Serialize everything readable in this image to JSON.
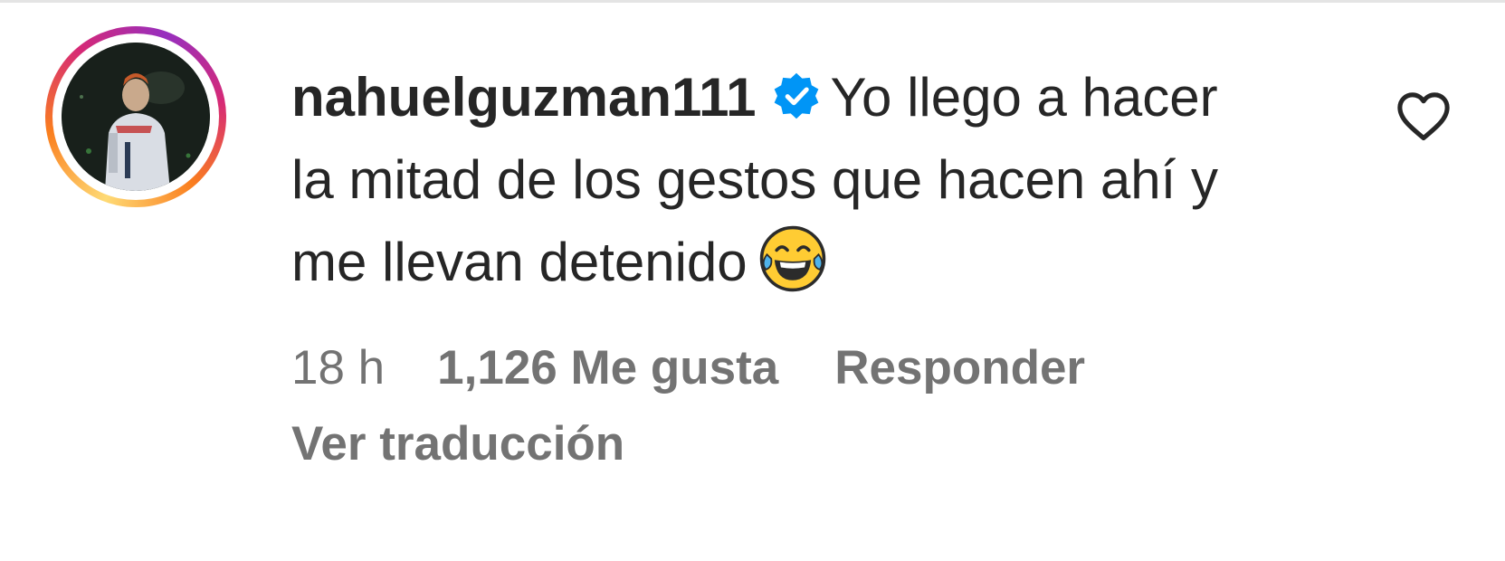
{
  "comment": {
    "username": "nahuelguzman111",
    "verified": true,
    "verified_icon": "verified-badge-icon",
    "text": "Yo llego a hacer la mitad de los gestos que hacen ahí y me llevan detenido",
    "emoji": "face-with-tears-of-joy-icon",
    "timestamp": "18 h",
    "likes": "1,126 Me gusta",
    "reply_label": "Responder",
    "translate_label": "Ver traducción",
    "like_icon": "heart-outline-icon"
  },
  "colors": {
    "text_primary": "#262626",
    "text_secondary": "#737373",
    "verified_blue": "#0095f6",
    "divider": "#e4e4e4"
  }
}
